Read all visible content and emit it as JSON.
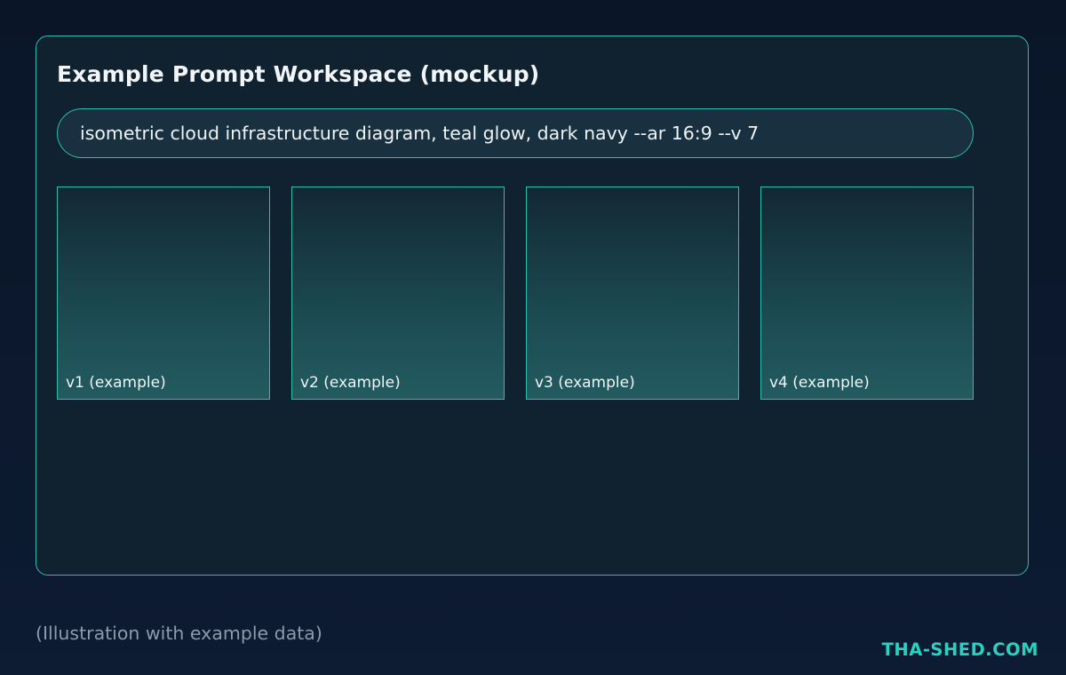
{
  "workspace": {
    "title": "Example Prompt Workspace (mockup)",
    "prompt_value": "isometric cloud infrastructure diagram, teal glow, dark navy --ar 16:9 --v 7"
  },
  "variations": [
    {
      "label": "v1 (example)"
    },
    {
      "label": "v2 (example)"
    },
    {
      "label": "v3 (example)"
    },
    {
      "label": "v4 (example)"
    }
  ],
  "footer": {
    "caption": "(Illustration with example data)",
    "brand": "THA-SHED.COM"
  },
  "colors": {
    "accent": "#2bbfb0",
    "brand": "#2bd1c0",
    "background": "#0a1628"
  }
}
